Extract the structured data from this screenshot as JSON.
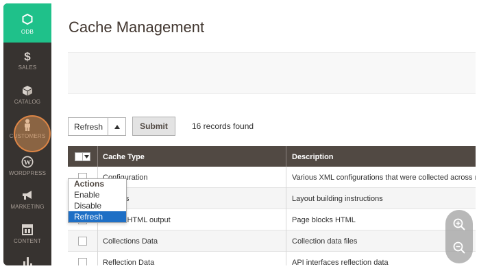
{
  "sidebar": {
    "logo_label": "ODB",
    "items": [
      {
        "label": "SALES",
        "icon": "dollar-icon"
      },
      {
        "label": "CATALOG",
        "icon": "cube-icon"
      },
      {
        "label": "CUSTOMERS",
        "icon": "person-icon"
      },
      {
        "label": "WORDPRESS",
        "icon": "wordpress-icon"
      },
      {
        "label": "MARKETING",
        "icon": "megaphone-icon"
      },
      {
        "label": "CONTENT",
        "icon": "layout-icon"
      },
      {
        "label": "",
        "icon": "bar-chart-icon"
      }
    ],
    "colors": {
      "background": "#373330",
      "logo_tile": "#1fc18a",
      "label": "#a79d95"
    }
  },
  "page": {
    "title": "Cache Management"
  },
  "toolbar": {
    "mass_action_value": "Refresh",
    "submit_label": "Submit",
    "records_found": "16 records found"
  },
  "grid": {
    "columns": {
      "cache_type": "Cache Type",
      "description": "Description"
    },
    "rows": [
      {
        "type": "Configuration",
        "description": "Various XML configurations that were collected across m"
      },
      {
        "type": "Layouts",
        "description": "Layout building instructions"
      },
      {
        "type": "Blocks HTML output",
        "description": "Page blocks HTML"
      },
      {
        "type": "Collections Data",
        "description": "Collection data files"
      },
      {
        "type": "Reflection Data",
        "description": "API interfaces reflection data"
      }
    ],
    "colors": {
      "header": "#514943"
    }
  },
  "actions_menu": {
    "header": "Actions",
    "options": [
      "Enable",
      "Disable",
      "Refresh"
    ],
    "selected": "Refresh",
    "colors": {
      "selected": "#1e6fc5"
    }
  },
  "zoom_controls": {
    "zoom_in_icon": "zoom-in-icon",
    "zoom_out_icon": "zoom-out-icon"
  },
  "click_indicator": {
    "color": "#f0a05a"
  }
}
